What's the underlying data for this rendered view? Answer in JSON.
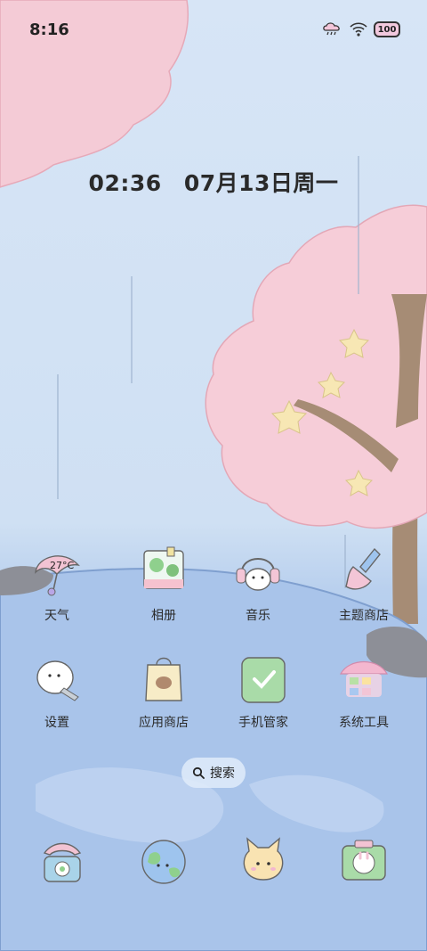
{
  "status_bar": {
    "time": "8:16",
    "battery": "100",
    "icons": [
      "weather-rain-icon",
      "wifi-icon",
      "battery-icon"
    ]
  },
  "clock": {
    "time": "02:36",
    "date": "07月13日周一"
  },
  "apps": [
    {
      "id": "weather",
      "label": "天气",
      "icon": "weather-umbrella-icon",
      "icon_text": "27°C"
    },
    {
      "id": "gallery",
      "label": "相册",
      "icon": "gallery-picture-icon"
    },
    {
      "id": "music",
      "label": "音乐",
      "icon": "music-headphones-icon"
    },
    {
      "id": "themes",
      "label": "主题商店",
      "icon": "theme-brush-icon"
    },
    {
      "id": "settings",
      "label": "设置",
      "icon": "settings-wrench-icon"
    },
    {
      "id": "appstore",
      "label": "应用商店",
      "icon": "app-store-bag-icon"
    },
    {
      "id": "security",
      "label": "手机管家",
      "icon": "security-shield-icon"
    },
    {
      "id": "tools",
      "label": "系统工具",
      "icon": "tools-folder-icon"
    }
  ],
  "search": {
    "label": "搜索",
    "icon": "search-icon"
  },
  "dock": [
    {
      "id": "phone",
      "icon": "phone-icon"
    },
    {
      "id": "browser",
      "icon": "browser-globe-icon"
    },
    {
      "id": "messages",
      "icon": "messages-bunny-icon"
    },
    {
      "id": "camera",
      "icon": "camera-icon"
    }
  ]
}
